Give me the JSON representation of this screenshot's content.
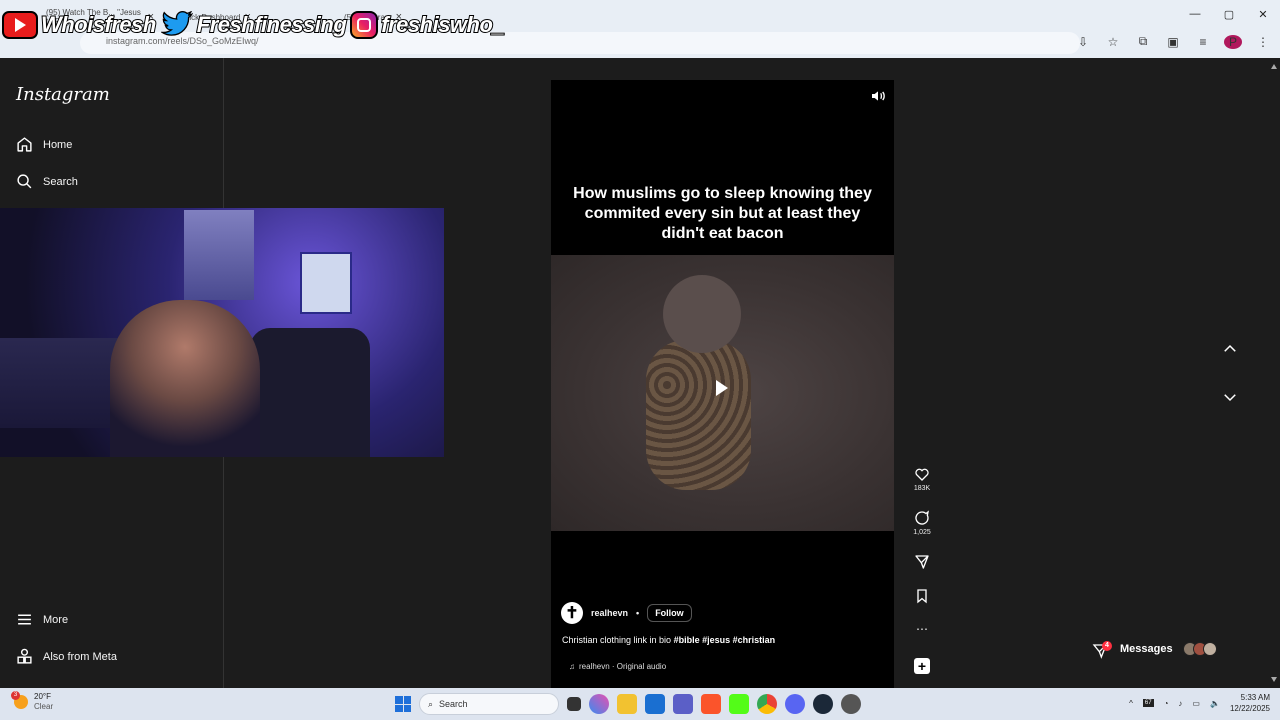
{
  "browser": {
    "tabs": [
      {
        "label": "(95) Watch The B... \"Jesus to Play",
        "close": "×"
      },
      {
        "label": "Kick Dashboard",
        "close": "×"
      },
      {
        "label": "(5) Instagram",
        "close": "×"
      }
    ],
    "url": "instagram.com/reels/DSo_GoMzEIwq/",
    "window_controls": {
      "minimize": "—",
      "maximize": "▢",
      "close": "✕"
    },
    "profile_initial": "P"
  },
  "overlay": {
    "youtube": "Whoisfresh",
    "twitter": "Freshfinessing",
    "instagram": "freshiswho_"
  },
  "sidebar": {
    "logo": "Instagram",
    "items": [
      {
        "label": "Home"
      },
      {
        "label": "Search"
      },
      {
        "label": "More"
      },
      {
        "label": "Also from Meta"
      }
    ]
  },
  "reel": {
    "caption_overlay": "How muslims go to sleep knowing they commited every sin but at least they didn't eat bacon",
    "author": "realhevn",
    "separator": "•",
    "follow_label": "Follow",
    "description": "Christian clothing link in bio",
    "hashtags": "#bible #jesus #christian",
    "audio": "realhevn · Original audio"
  },
  "actions": {
    "likes": "183K",
    "comments": "1,025"
  },
  "messages": {
    "label": "Messages",
    "badge": "4"
  },
  "taskbar": {
    "weather_temp": "20°F",
    "weather_desc": "Clear",
    "weather_badge": "3",
    "search_placeholder": "Search",
    "time": "5:33 AM",
    "date": "12/22/2025",
    "tray_badge": "67"
  },
  "colors": {
    "instagram_bg": "#1c1c1c",
    "reel_bg": "#000000",
    "notification_red": "#ff3040",
    "youtube_red": "#e81c1c"
  }
}
